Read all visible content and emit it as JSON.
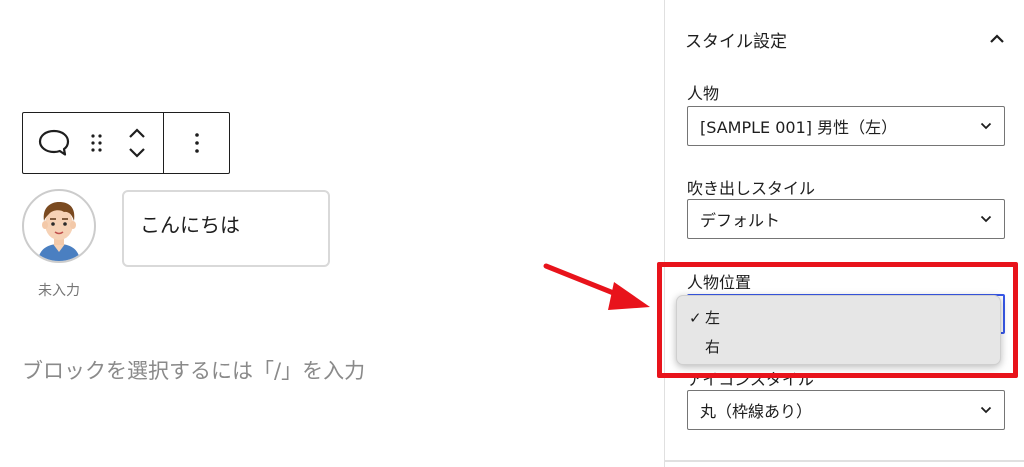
{
  "editor": {
    "block_placeholder": "ブロックを選択するには「/」を入力",
    "speech_bubble": {
      "text": "こんにちは",
      "avatar_caption": "未入力"
    },
    "toolbar": {
      "block_type_icon": "speech-bubble-icon",
      "drag_icon": "drag-handle-icon",
      "move_icon": "move-up-down-icon",
      "more_icon": "more-vertical-icon"
    }
  },
  "sidebar": {
    "panel_title": "スタイル設定",
    "fields": {
      "person": {
        "label": "人物",
        "value": "[SAMPLE 001] 男性（左）"
      },
      "bubble_style": {
        "label": "吹き出しスタイル",
        "value": "デフォルト"
      },
      "person_position": {
        "label": "人物位置",
        "options": [
          {
            "label": "左",
            "selected": true
          },
          {
            "label": "右",
            "selected": false
          }
        ]
      },
      "icon_style": {
        "label": "アイコンスタイル",
        "value": "丸（枠線あり）"
      }
    }
  },
  "annotations": {
    "highlight_color": "#e8131b"
  },
  "colors": {
    "focus_blue": "#3858e9",
    "text": "#1e1e1e",
    "muted": "#757575"
  }
}
